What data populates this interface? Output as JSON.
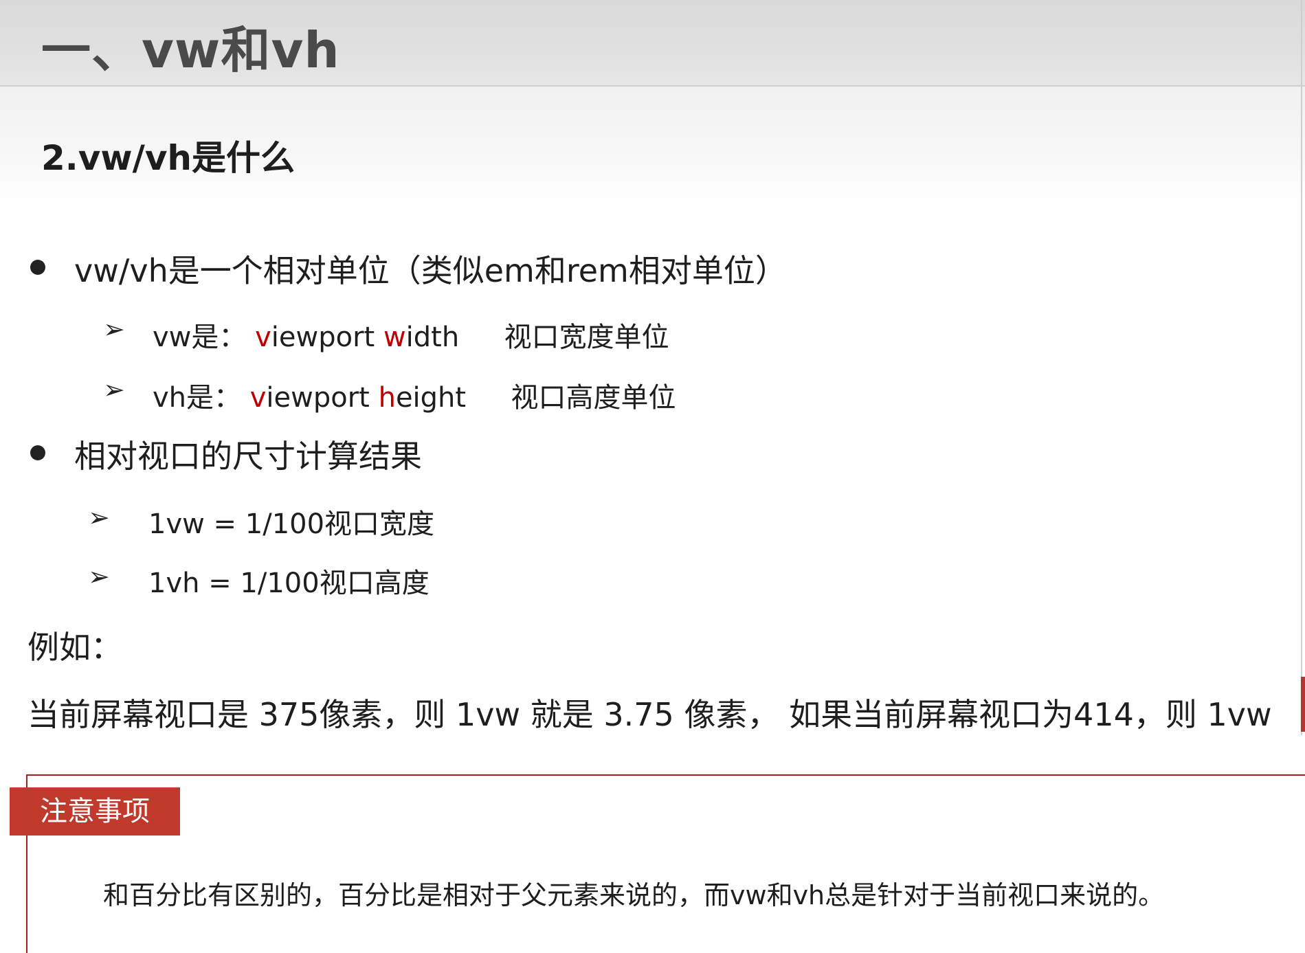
{
  "header": {
    "title": "一、vw和vh",
    "subtitle": "2.vw/vh是什么"
  },
  "bullets": [
    {
      "text": "vw/vh是一个相对单位（类似em和rem相对单位）",
      "items": [
        {
          "label": "vw是：",
          "term_initial": "v",
          "term_rest_a": "iewport ",
          "term_initial_b": "w",
          "term_rest_b": "idth",
          "desc": "视口宽度单位"
        },
        {
          "label": "vh是：",
          "term_initial": "v",
          "term_rest_a": "iewport ",
          "term_initial_b": "h",
          "term_rest_b": "eight",
          "desc": "视口高度单位"
        }
      ]
    },
    {
      "text": "相对视口的尺寸计算结果",
      "items": [
        {
          "text": "1vw = 1/100视口宽度"
        },
        {
          "text": "1vh = 1/100视口高度"
        }
      ]
    }
  ],
  "example": {
    "label": "例如：",
    "text": "当前屏幕视口是 375像素，则 1vw 就是  3.75 像素，  如果当前屏幕视口为414，则 1vw"
  },
  "note": {
    "tag": "注意事项",
    "text": "和百分比有区别的，百分比是相对于父元素来说的，而vw和vh总是针对于当前视口来说的。"
  },
  "colors": {
    "accent_red": "#c00000",
    "tag_bg": "#c0392b",
    "box_border": "#a51d1d"
  }
}
